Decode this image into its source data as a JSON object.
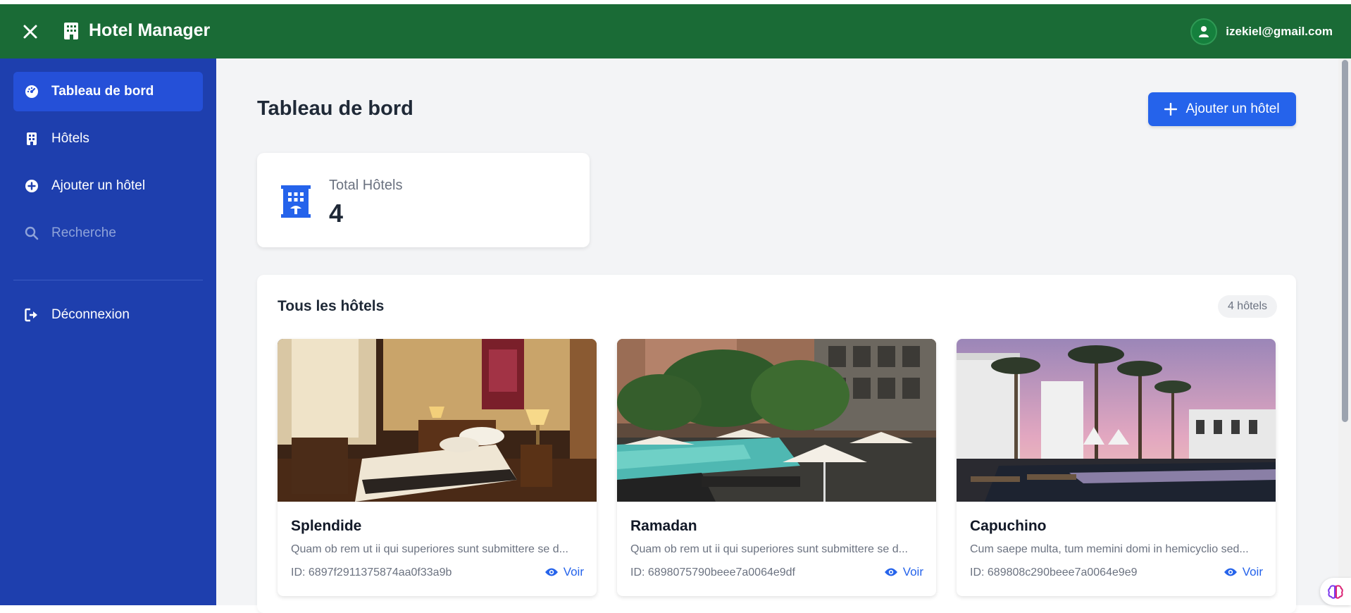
{
  "topbar": {
    "app_title": "Hotel Manager",
    "user_email": "izekiel@gmail.com",
    "background": "#1a6b36"
  },
  "sidebar": {
    "background": "#1e3fae",
    "items": [
      {
        "label": "Tableau de bord",
        "icon": "dashboard-icon",
        "active": true
      },
      {
        "label": "Hôtels",
        "icon": "building-icon"
      },
      {
        "label": "Ajouter un hôtel",
        "icon": "plus-circle-icon"
      },
      {
        "label": "Recherche",
        "icon": "search-icon",
        "muted": true
      },
      {
        "label": "Déconnexion",
        "icon": "logout-icon"
      }
    ]
  },
  "main": {
    "title": "Tableau de bord",
    "add_button_label": "Ajouter un hôtel",
    "accent": "#2563eb",
    "stat": {
      "label": "Total Hôtels",
      "value": "4",
      "icon": "hotel-icon"
    },
    "hotels_panel": {
      "title": "Tous les hôtels",
      "count_badge": "4 hôtels",
      "hotels": [
        {
          "name": "Splendide",
          "description": "Quam ob rem ut ii qui superiores sunt submittere se d...",
          "id_text": "ID: 6897f2911375874aa0f33a9b",
          "view_label": "Voir",
          "image": "hotel-bedroom-photo"
        },
        {
          "name": "Ramadan",
          "description": "Quam ob rem ut ii qui superiores sunt submittere se d...",
          "id_text": "ID: 6898075790beee7a0064e9df",
          "view_label": "Voir",
          "image": "resort-pool-photo"
        },
        {
          "name": "Capuchino",
          "description": "Cum saepe multa, tum memini domi in hemicyclio sed...",
          "id_text": "ID: 689808c290beee7a0064e9e9",
          "view_label": "Voir",
          "image": "palm-pool-sunset-photo"
        }
      ]
    }
  }
}
